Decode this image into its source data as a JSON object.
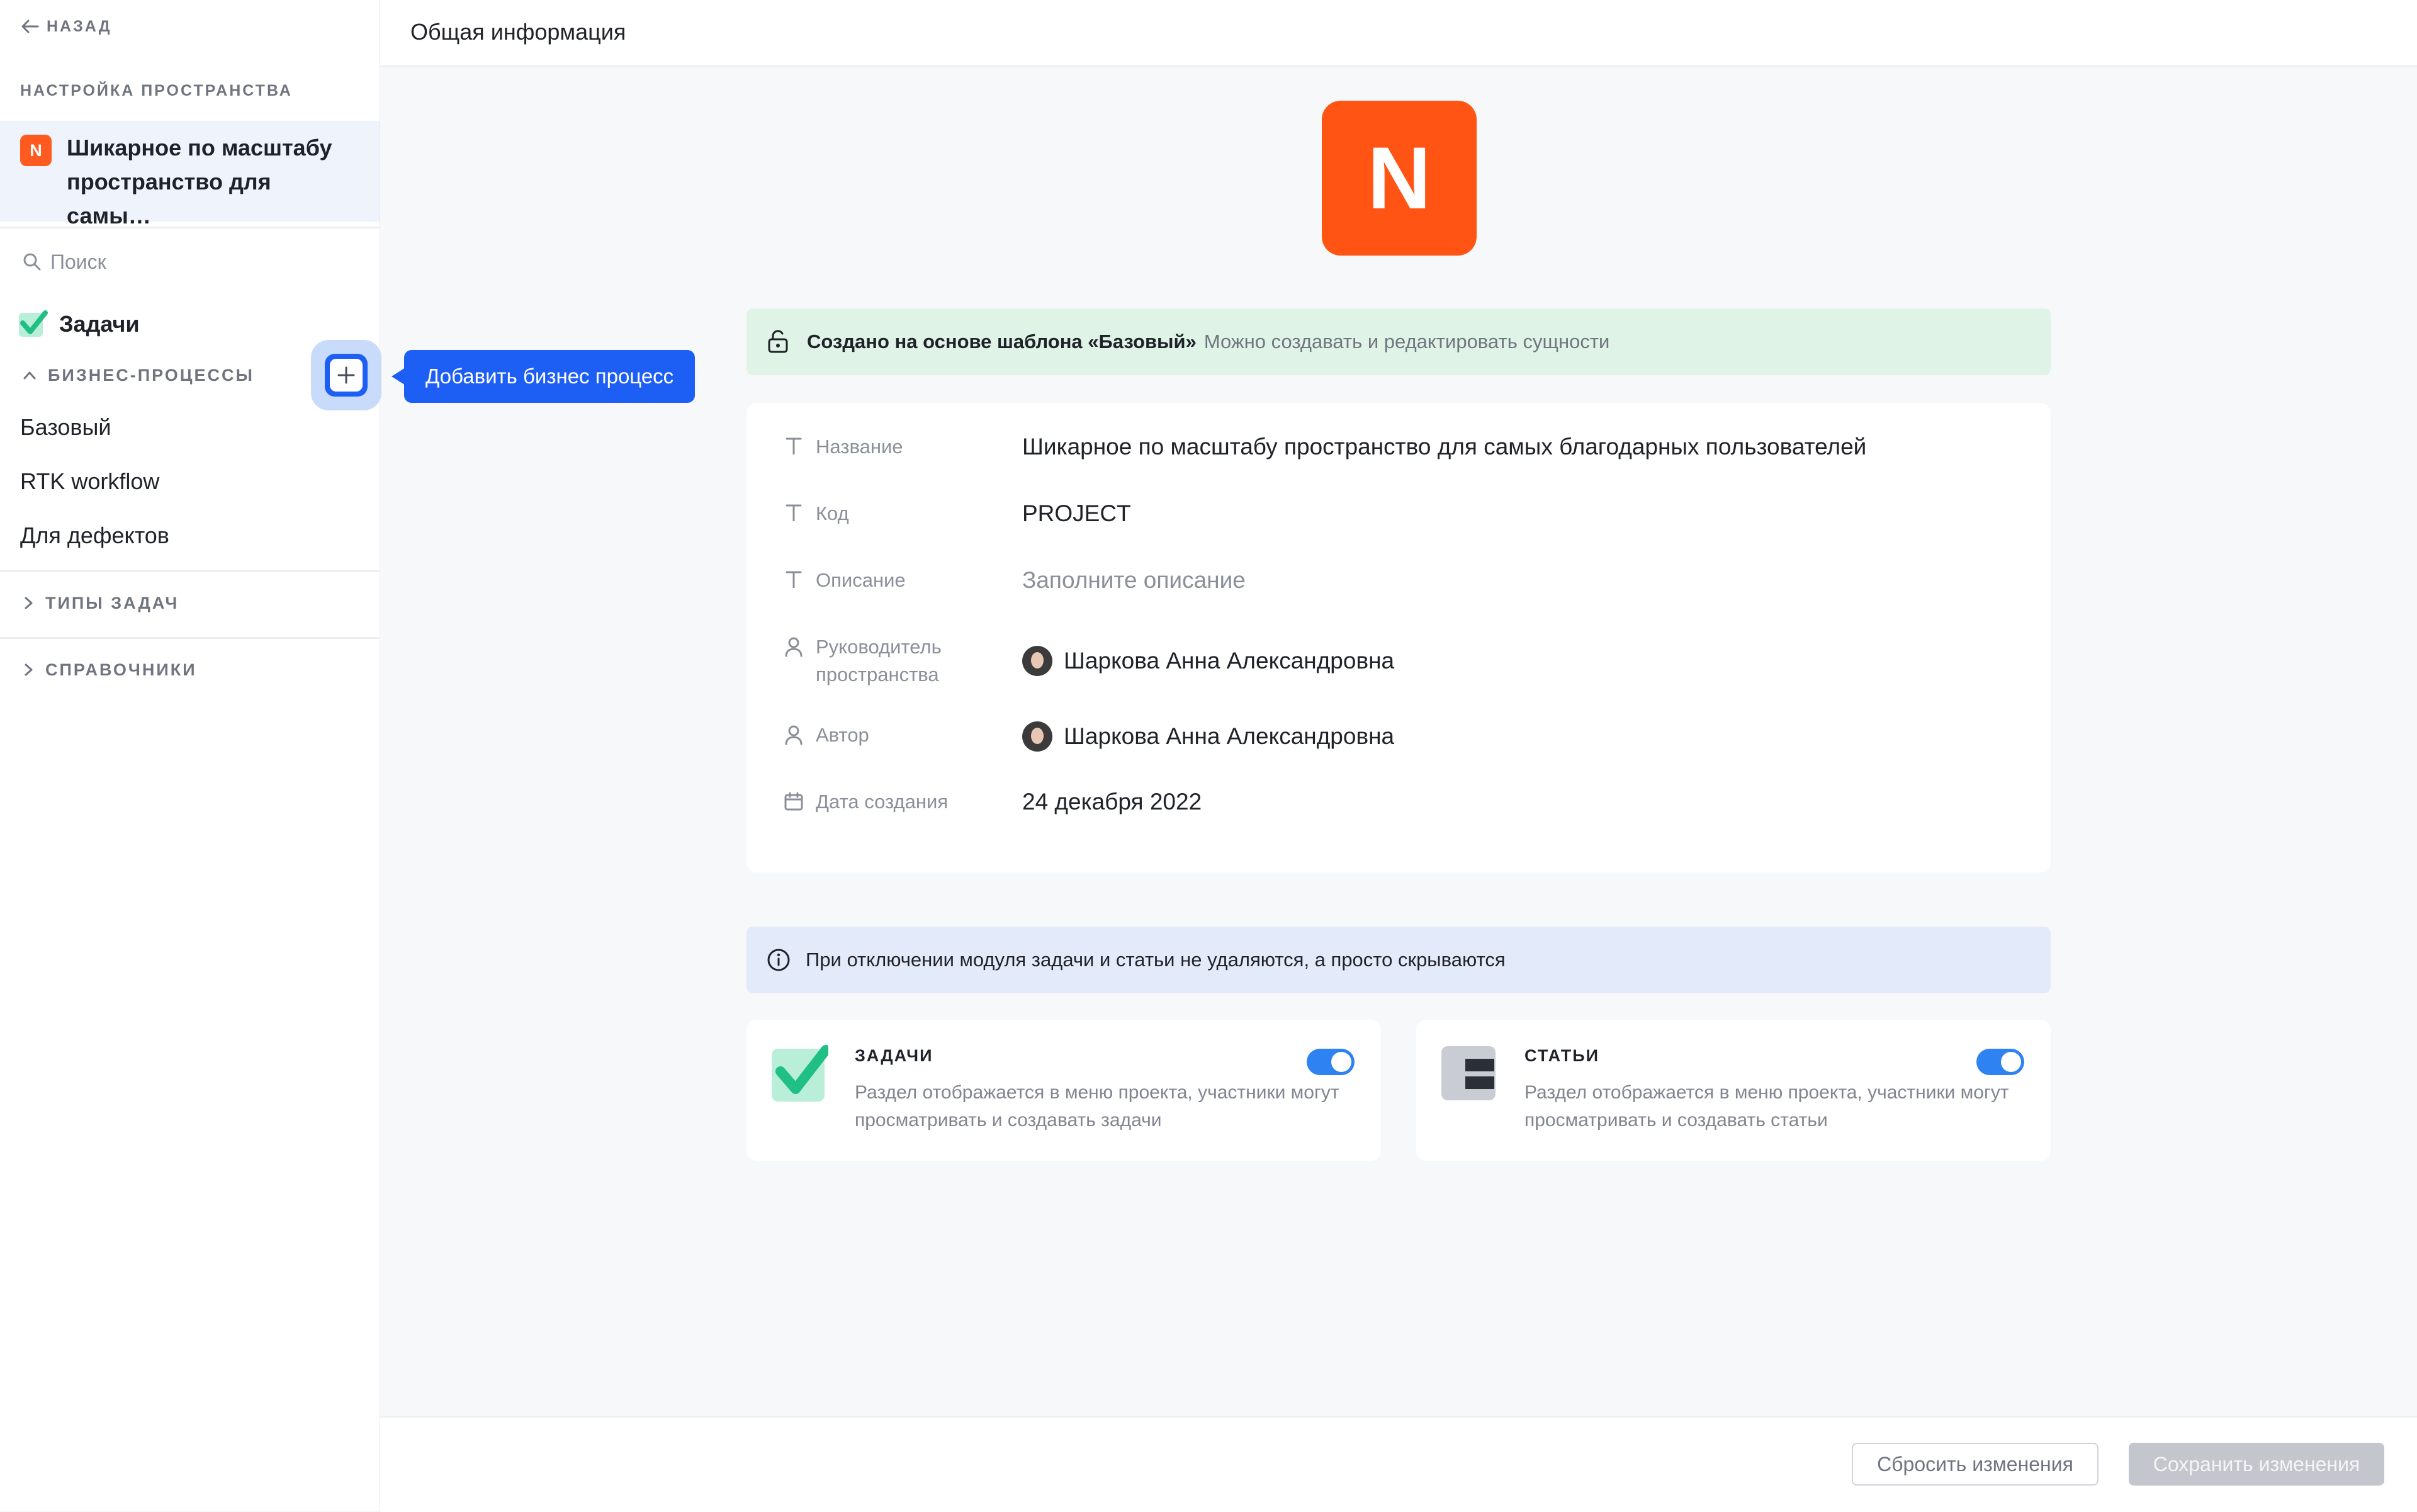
{
  "sidebar": {
    "back_label": "НАЗАД",
    "section_title": "НАСТРОЙКА ПРОСТРАНСТВА",
    "space": {
      "badge": "N",
      "name": "Шикарное по масштабу пространство для самы…"
    },
    "search_placeholder": "Поиск",
    "tasks_label": "Задачи",
    "bp_group_label": "БИЗНЕС-ПРОЦЕССЫ",
    "bp_items": [
      "Базовый",
      "RTK workflow",
      "Для дефектов"
    ],
    "task_types_label": "ТИПЫ ЗАДАЧ",
    "dictionaries_label": "СПРАВОЧНИКИ",
    "add_tooltip": "Добавить бизнес процесс"
  },
  "header": {
    "title": "Общая информация"
  },
  "logo_letter": "N",
  "template_banner": {
    "strong": "Создано на основе шаблона «Базовый»",
    "muted": "Можно создавать и редактировать сущности"
  },
  "info": {
    "name_label": "Название",
    "name_value": "Шикарное по масштабу пространство для самых благодарных пользователей",
    "code_label": "Код",
    "code_value": "PROJECT",
    "desc_label": "Описание",
    "desc_placeholder": "Заполните описание",
    "lead_label": "Руководитель пространства",
    "lead_value": "Шаркова Анна Александровна",
    "author_label": "Автор",
    "author_value": "Шаркова Анна Александровна",
    "date_label": "Дата создания",
    "date_value": "24 декабря 2022"
  },
  "modules_banner": "При отключении модуля задачи и статьи не удаляются, а просто скрываются",
  "modules": {
    "tasks": {
      "title": "ЗАДАЧИ",
      "desc": "Раздел отображается в меню проекта, участники могут просматривать и создавать задачи",
      "enabled": true,
      "icon": "tasks-check-icon"
    },
    "articles": {
      "title": "СТАТЬИ",
      "desc": "Раздел отображается в меню проекта, участники могут просматривать и создавать статьи",
      "enabled": true,
      "icon": "articles-icon"
    }
  },
  "footer": {
    "reset_label": "Сбросить изменения",
    "save_label": "Сохранить изменения"
  },
  "colors": {
    "accent": "#1d5ff5",
    "brand": "#ff5413",
    "toggle": "#2e82f2",
    "tasks_green": "#27c28a"
  }
}
